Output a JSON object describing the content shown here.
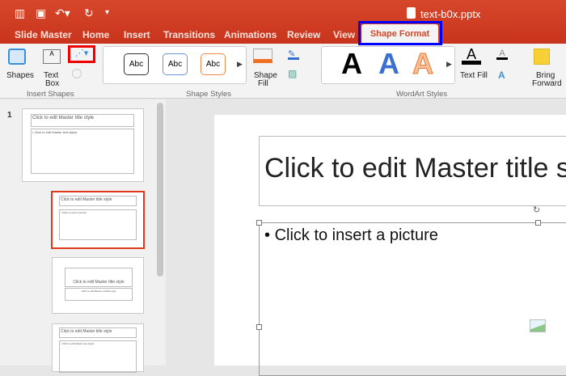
{
  "window": {
    "filename": "text-b0x.pptx"
  },
  "quick_access": {
    "icons": [
      "sidebar-icon",
      "save-icon",
      "undo-icon",
      "redo-icon",
      "customize-icon"
    ]
  },
  "tabs": [
    "Slide Master",
    "Home",
    "Insert",
    "Transitions",
    "Animations",
    "Review",
    "View",
    "Shape Format"
  ],
  "active_tab": "Shape Format",
  "ribbon": {
    "insert_shapes": {
      "shapes": "Shapes",
      "text_box_1": "Text",
      "text_box_2": "Box",
      "group": "Insert Shapes"
    },
    "shape_styles": {
      "samples": [
        "Abc",
        "Abc",
        "Abc"
      ],
      "sample_colors": [
        "#333333",
        "#6a95d8",
        "#f08a4b"
      ],
      "shape_fill_1": "Shape",
      "shape_fill_2": "Fill",
      "group": "Shape Styles"
    },
    "wordart": {
      "letters": [
        "A",
        "A",
        "A"
      ],
      "text_fill": "Text Fill",
      "group": "WordArt Styles"
    },
    "arrange": {
      "bring_forward_1": "Bring",
      "bring_forward_2": "Forward"
    }
  },
  "thumbnails": {
    "number": "1",
    "master_title": "Click to edit Master title style",
    "master_text": "• Click to edit Master text styles",
    "subtitle": "Click to edit Master subtitle style",
    "picture": "• Click to insert a picture"
  },
  "slide": {
    "title": "Click to edit Master title style",
    "content": "Click to insert a picture"
  }
}
